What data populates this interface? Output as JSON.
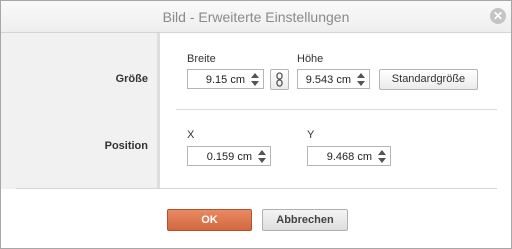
{
  "dialog": {
    "title": "Bild - Erweiterte Einstellungen",
    "close_glyph": "✕",
    "close_icon": "close-icon"
  },
  "sections": {
    "size_label": "Größe",
    "position_label": "Position"
  },
  "size": {
    "width_label": "Breite",
    "width_value": "9.15 cm",
    "height_label": "Höhe",
    "height_value": "9.543 cm",
    "lock_icon": "link-icon",
    "standard_label": "Standardgröße"
  },
  "position": {
    "x_label": "X",
    "x_value": "0.159 cm",
    "y_label": "Y",
    "y_value": "9.468 cm"
  },
  "buttons": {
    "ok": "OK",
    "cancel": "Abbrechen"
  },
  "colors": {
    "ok_bg": "#d4683f",
    "panel_bg": "#f1f1f1"
  }
}
